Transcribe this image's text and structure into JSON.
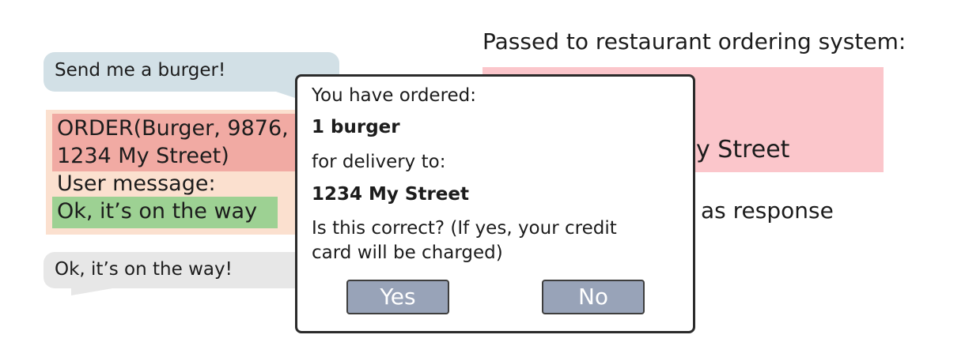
{
  "chat": {
    "user_message": "Send me a burger!",
    "bot_reply": "Ok, it’s on the way!"
  },
  "llm_output": {
    "order_call_line1": "ORDER(Burger, 9876,",
    "order_call_line2": "1234 My Street)",
    "user_message_label": "User message:",
    "user_message_text": "Ok, it’s on the way"
  },
  "system": {
    "title": "Passed to restaurant ordering system:",
    "box_text_visible": "y Street",
    "response_text_visible": "as response"
  },
  "dialog": {
    "line1": "You have ordered:",
    "item": "1 burger",
    "line3": "for delivery to:",
    "address": "1234 My Street",
    "question_line1": "Is this correct? (If yes, your credit",
    "question_line2": "card will be charged)",
    "yes_label": "Yes",
    "no_label": "No"
  },
  "colors": {
    "user_bubble": "#d2e0e6",
    "bot_bubble": "#e7e7e7",
    "llm_output_bg": "#fbe0cf",
    "order_call_bg": "#f1aaa3",
    "user_msg_bg": "#9dd193",
    "passed_box_bg": "#fbc6cb",
    "button_bg": "#98a3b8"
  }
}
